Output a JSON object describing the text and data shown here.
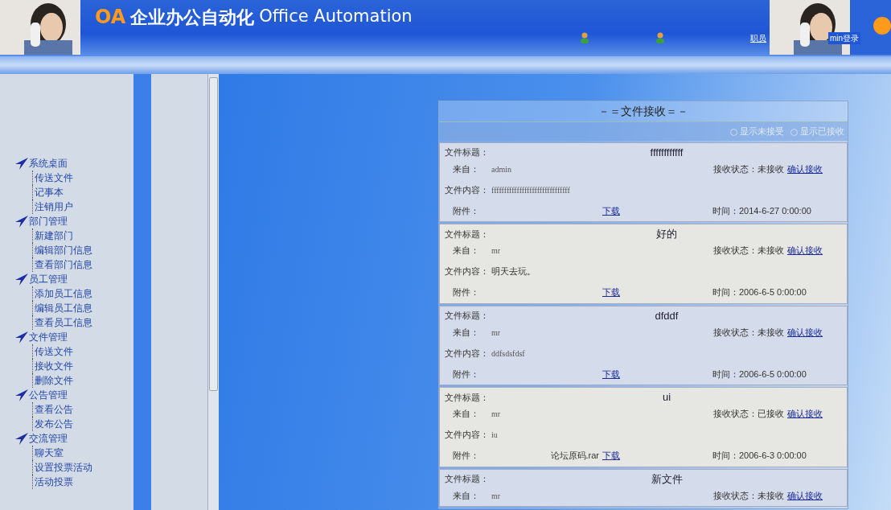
{
  "header": {
    "logo_mark": "OA",
    "title": "企业办公自动化",
    "subtitle": "Office Automation",
    "links": [
      {
        "label": "职员"
      },
      {
        "label": "min登录"
      }
    ]
  },
  "sidebar": {
    "items": [
      {
        "label": "系统桌面",
        "children": [
          {
            "label": "传送文件"
          },
          {
            "label": "记事本"
          },
          {
            "label": "注销用户"
          }
        ]
      },
      {
        "label": "部门管理",
        "children": [
          {
            "label": "新建部门"
          },
          {
            "label": "编辑部门信息"
          },
          {
            "label": "查看部门信息"
          }
        ]
      },
      {
        "label": "员工管理",
        "children": [
          {
            "label": "添加员工信息"
          },
          {
            "label": "编辑员工信息"
          },
          {
            "label": "查看员工信息"
          }
        ]
      },
      {
        "label": "文件管理",
        "children": [
          {
            "label": "传送文件"
          },
          {
            "label": "接收文件"
          },
          {
            "label": "删除文件"
          }
        ]
      },
      {
        "label": "公告管理",
        "children": [
          {
            "label": "查看公告"
          },
          {
            "label": "发布公告"
          }
        ]
      },
      {
        "label": "交流管理",
        "children": [
          {
            "label": "聊天室"
          },
          {
            "label": "设置投票活动"
          },
          {
            "label": "活动投票"
          }
        ]
      }
    ]
  },
  "panel": {
    "title": "－＝文件接收＝－",
    "filters": [
      {
        "label": "显示未接受",
        "selected": false
      },
      {
        "label": "显示已接收",
        "selected": false
      }
    ],
    "records": [
      {
        "title_label": "文件标题：",
        "title": "ffffffffffff",
        "from_label": "来自：",
        "from": "admin",
        "status_label": "接收状态：",
        "status": "未接收",
        "confirm": "确认接收",
        "content_label": "文件内容：",
        "content": "fffffffffffffffffffffffffffffff",
        "attachment_label": "附件：",
        "download": "下载",
        "time_label": "时间：",
        "time": "2014-6-27 0:00:00"
      },
      {
        "title_label": "文件标题：",
        "title": "好的",
        "from_label": "来自：",
        "from": "mr",
        "status_label": "接收状态：",
        "status": "未接收",
        "confirm": "确认接收",
        "content_label": "文件内容：",
        "content": "明天去玩。",
        "attachment_label": "附件：",
        "download": "下载",
        "time_label": "时间：",
        "time": "2006-6-5 0:00:00"
      },
      {
        "title_label": "文件标题：",
        "title": "dfddf",
        "from_label": "来自：",
        "from": "mr",
        "status_label": "接收状态：",
        "status": "未接收",
        "confirm": "确认接收",
        "content_label": "文件内容：",
        "content": "ddfsdsfdsf",
        "attachment_label": "附件：",
        "download": "下载",
        "time_label": "时间：",
        "time": "2006-6-5 0:00:00"
      },
      {
        "title_label": "文件标题：",
        "title": "ui",
        "from_label": "来自：",
        "from": "mr",
        "status_label": "接收状态：",
        "status": "已接收",
        "confirm": "确认接收",
        "content_label": "文件内容：",
        "content": "iu",
        "attachment_label": "附件：",
        "attachment_name": "论坛原码.rar",
        "download": "下载",
        "time_label": "时间：",
        "time": "2006-6-3 0:00:00"
      },
      {
        "title_label": "文件标题：",
        "title": "新文件",
        "from_label": "来自：",
        "from": "mr",
        "status_label": "接收状态：",
        "status": "未接收",
        "confirm": "确认接收"
      }
    ]
  }
}
